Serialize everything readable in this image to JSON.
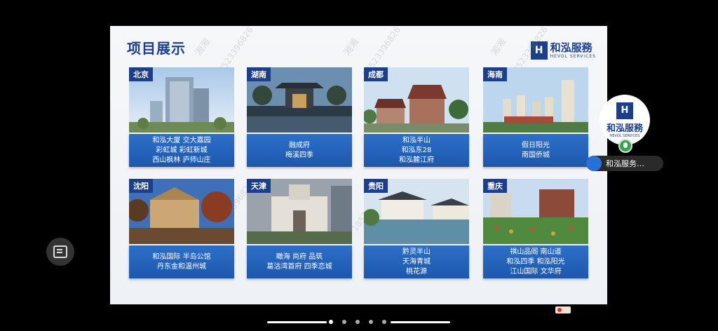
{
  "slide": {
    "title": "项目展示",
    "logo": {
      "cn": "和泓服務",
      "en": "HEVOL SERVICES",
      "mark": "H"
    },
    "watermarks": [
      "湘湘",
      "18523396826",
      "湘湘",
      "18523396826",
      "湘湘",
      "18523396826",
      "18523396826",
      "18523396826"
    ]
  },
  "cards": [
    {
      "region": "北京",
      "lines": [
        "和泓大厦 交大嘉园",
        "彩虹城 彩虹新城",
        "西山枫林 庐师山庄"
      ]
    },
    {
      "region": "湖南",
      "lines": [
        "融成府",
        "梅溪四季"
      ]
    },
    {
      "region": "成都",
      "lines": [
        "和泓半山",
        "和泓东28",
        "和泓麓江府"
      ]
    },
    {
      "region": "海南",
      "lines": [
        "假日阳光",
        "南国侨城"
      ]
    },
    {
      "region": "沈阳",
      "lines": [
        "和泓国际 半岛公馆",
        "丹东金和温州城"
      ]
    },
    {
      "region": "天津",
      "lines": [
        "瞰海 尚府 品筑",
        "葛沽湾首府 四季恋城"
      ]
    },
    {
      "region": "贵阳",
      "lines": [
        "黔灵半山",
        "天海青城",
        "桃花源"
      ]
    },
    {
      "region": "重庆",
      "lines": [
        "祺山品阁 南山道",
        "和泓四季 和泓阳光",
        "江山国际 文华府"
      ]
    }
  ],
  "overlay": {
    "floating_logo": {
      "cn": "和泓服務",
      "en": "HEVOL SERVICES",
      "mark": "H"
    },
    "pill_label": "和泓服务…",
    "chat_icon": "chat-icon",
    "mic_icon": "mic-icon",
    "user_icon": "user-icon"
  },
  "colors": {
    "brand": "#1b3f8c",
    "label_bg": "#2563b8",
    "background": "#000000"
  }
}
